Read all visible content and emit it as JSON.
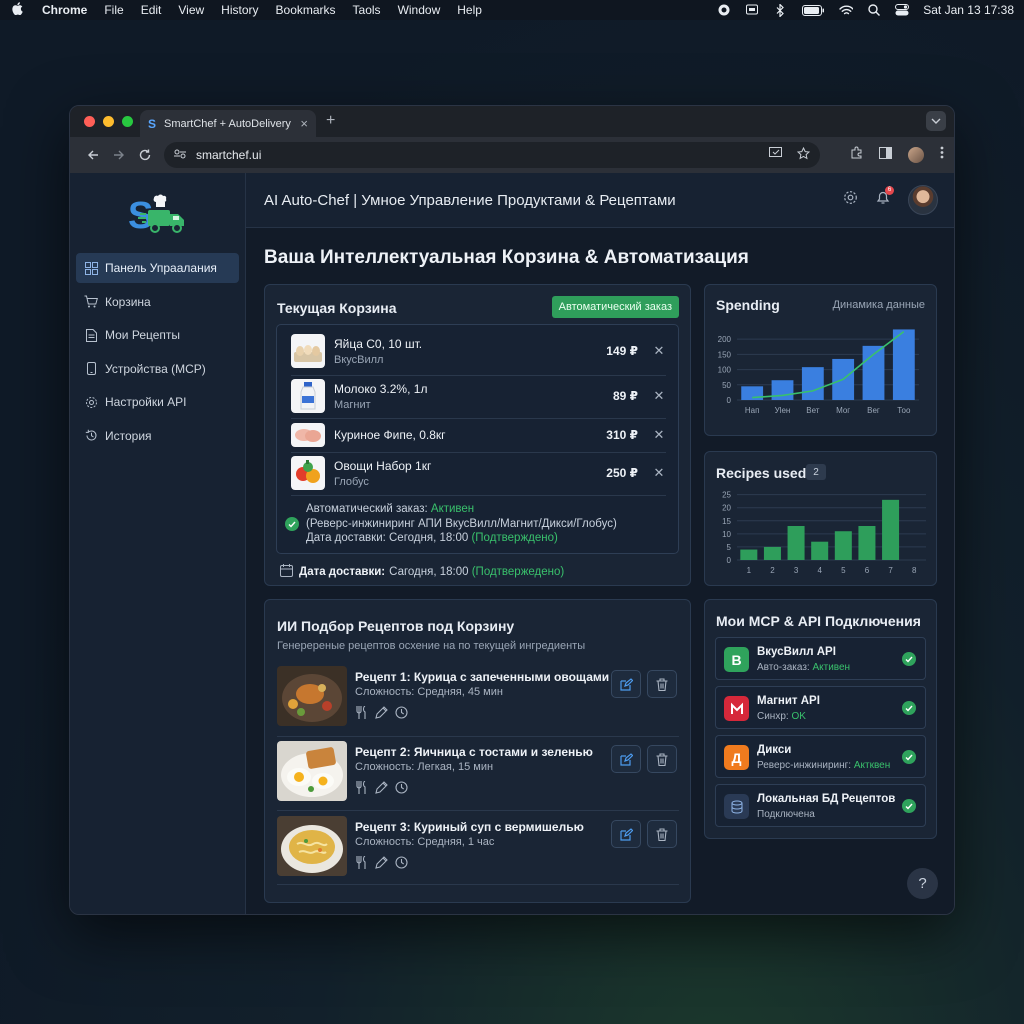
{
  "menubar": {
    "items": [
      "Chrome",
      "File",
      "Edit",
      "View",
      "History",
      "Bookmarks",
      "Taols",
      "Window",
      "Help"
    ],
    "datetime": "Sat Jan 13  17:38"
  },
  "browser": {
    "tab_title": "SmartChef + AutoDelivery",
    "url": "smartchef.ui"
  },
  "app": {
    "header_title": "AI Auto-Chef | Умное Управление Продуктами & Рецептами",
    "notifications_count": "6",
    "page_title": "Ваша Интеллектуальная Корзина & Автоматизация"
  },
  "sidebar": {
    "items": [
      {
        "label": "Панель Упраалания",
        "icon": "grid-icon",
        "active": true
      },
      {
        "label": "Корзина",
        "icon": "cart-icon"
      },
      {
        "label": "Мои Рецепты",
        "icon": "document-icon"
      },
      {
        "label": "Устройства (МСР)",
        "icon": "phone-icon"
      },
      {
        "label": "Настройки API",
        "icon": "gear-icon"
      },
      {
        "label": "История",
        "icon": "history-icon"
      }
    ]
  },
  "cart": {
    "title": "Текущая Корзина",
    "auto_badge": "Автоматический заказ",
    "items": [
      {
        "name": "Яйца С0, 10 шт.",
        "store": "ВкусВилл",
        "price": "149 ₽"
      },
      {
        "name": "Молоко 3.2%, 1л",
        "store": "Магнит",
        "price": "89 ₽"
      },
      {
        "name": "Куриное Фипе, 0.8кг",
        "store": "",
        "price": "310 ₽"
      },
      {
        "name": "Овощи Набор 1кг",
        "store": "Глобус",
        "price": "250 ₽"
      }
    ],
    "auto_status": {
      "label": "Автоматический заказ:",
      "value": "Активен",
      "detail": "(Реверс-инжиниринг АПИ ВкусВилл/Магнит/Дикси/Глобус)",
      "delivery_label": "Дата доставки: Сегодня, 18:00",
      "delivery_status": "(Подтверждено)"
    },
    "delivery": {
      "label": "Дата доставки:",
      "value": "Сагодня, 18:00",
      "status": "(Подтвержедено)"
    }
  },
  "spending": {
    "title": "Spending",
    "subtitle": "Динамика данные"
  },
  "recipes_used": {
    "title": "Recipes used",
    "count": "2"
  },
  "chart_data": [
    {
      "type": "bar",
      "title": "Spending",
      "categories": [
        "Нап",
        "Уlен",
        "Вет",
        "Мог",
        "Вег",
        "Тоо"
      ],
      "values": [
        45,
        65,
        108,
        135,
        178,
        232
      ],
      "trend": [
        8,
        15,
        30,
        68,
        150,
        225
      ],
      "ylim": [
        0,
        240
      ],
      "yticks": [
        0,
        50,
        100,
        150,
        200
      ],
      "grid": true
    },
    {
      "type": "bar",
      "title": "Recipes used",
      "categories": [
        "1",
        "2",
        "3",
        "4",
        "5",
        "6",
        "7",
        "8"
      ],
      "values": [
        4,
        5,
        13,
        7,
        11,
        13,
        23,
        0
      ],
      "ylim": [
        0,
        26
      ],
      "yticks": [
        0,
        5,
        10,
        15,
        20,
        25
      ],
      "grid": true
    }
  ],
  "ai_recipes": {
    "title": "ИИ Подбор Рецептов под Корзину",
    "subtitle": "Генеререные рецептов осхение на по текущей ингредиенты",
    "items": [
      {
        "title": "Рецепт 1: Курица с запеченными овощами",
        "detail": "Сложность: Средняя, 45 мин"
      },
      {
        "title": "Рецепт 2: Яичница с тостами и зеленью",
        "detail": "Сложность: Легкая, 15 мин"
      },
      {
        "title": "Рецепт 3: Куриный суп с вермишелью",
        "detail": "Сложность: Средняя, 1 час"
      }
    ]
  },
  "mcp": {
    "title": "Мои МСР & API Подключения",
    "items": [
      {
        "name": "ВкусВилл API",
        "label": "Авто-заказ:",
        "status": "Активен",
        "color": "#2fa35c",
        "logo": "В"
      },
      {
        "name": "Магнит API",
        "label": "Синхр:",
        "status": "OK",
        "color": "#d6283a",
        "logo": "M"
      },
      {
        "name": "Дикси",
        "label": "Реверс-инжиниринг:",
        "status": "Актквен",
        "color": "#f07b1e",
        "logo": "Д"
      },
      {
        "name": "Локальная БД Рецептов",
        "label": "",
        "status": "Подключена",
        "color": "#2a3a55",
        "logo": "db"
      }
    ]
  },
  "help_label": "?"
}
